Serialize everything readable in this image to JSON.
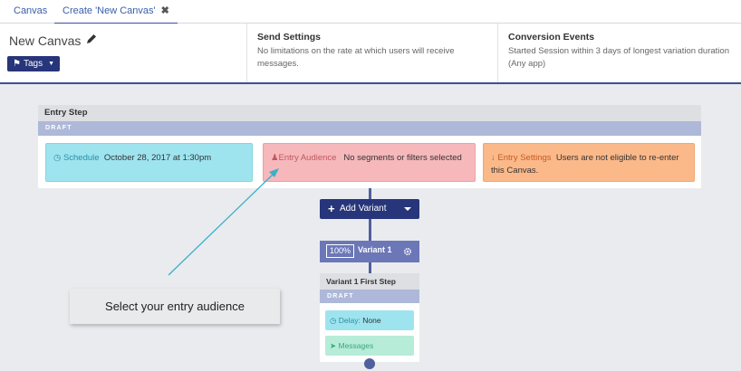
{
  "tabs": [
    {
      "label": "Canvas"
    },
    {
      "label": "Create 'New Canvas'"
    }
  ],
  "header": {
    "canvas_name": "New Canvas",
    "tags_label": "Tags",
    "send_settings": {
      "title": "Send Settings",
      "text": "No limitations on the rate at which users will receive messages."
    },
    "conversion_events": {
      "title": "Conversion Events",
      "text": "Started Session within 3 days of longest variation duration (Any app)"
    }
  },
  "entry_step": {
    "title": "Entry Step",
    "status": "DRAFT",
    "schedule": {
      "label": "Schedule",
      "value": "October 28, 2017 at 1:30pm"
    },
    "audience": {
      "label": "Entry Audience",
      "value": "No segments or filters selected"
    },
    "settings": {
      "label": "Entry Settings",
      "value": "Users are not eligible to re-enter this Canvas."
    }
  },
  "add_variant_label": "Add Variant",
  "variant": {
    "percent": "100%",
    "name": "Variant 1"
  },
  "variant_step": {
    "title": "Variant 1 First Step",
    "status": "DRAFT",
    "delay_label": "Delay:",
    "delay_value": "None",
    "messages_label": "Messages"
  },
  "callout_text": "Select your entry audience",
  "colors": {
    "primary": "#27357a",
    "schedule_bg": "#9ee4ef",
    "audience_bg": "#f6b8bb",
    "settings_bg": "#fbb98a",
    "messages_bg": "#b7ecd9",
    "arrow": "#3bb0c9"
  },
  "icons": {
    "edit": "pencil-icon",
    "tags": "tag-icon",
    "close": "close-icon",
    "schedule": "clock-icon",
    "audience": "users-icon",
    "settings": "arrow-down-icon",
    "add": "plus-icon",
    "dropdown": "caret-down-icon",
    "variant_settings": "gear-icon",
    "messages": "paper-plane-icon"
  }
}
